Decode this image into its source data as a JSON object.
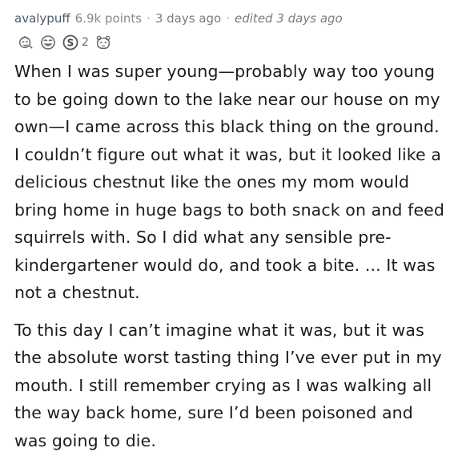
{
  "comment": {
    "author": "avalypuff",
    "points": "6.9k points",
    "separator": "·",
    "age": "3 days ago",
    "edited": "edited 3 days ago",
    "awards": [
      {
        "icon": "face-with-tongue-award-icon"
      },
      {
        "icon": "laughing-face-award-icon"
      },
      {
        "icon": "silver-s-award-icon",
        "count": "2"
      },
      {
        "icon": "wholesome-hamster-award-icon"
      }
    ],
    "paragraphs": [
      "When I was super young—probably way too young to be going down to the lake near our house on my own—I came across this black thing on the ground. I couldn’t figure out what it was, but it looked like a delicious chestnut like the ones my mom would bring home in huge bags to both snack on and feed squirrels with. So I did what any sensible pre-kindergartener would do, and took a bite. ... It was not a chestnut.",
      "To this day I can’t imagine what it was, but it was the absolute worst tasting thing I’ve ever put in my mouth. I still remember crying as I was walking all the way back home, sure I’d been poisoned and was going to die."
    ]
  }
}
